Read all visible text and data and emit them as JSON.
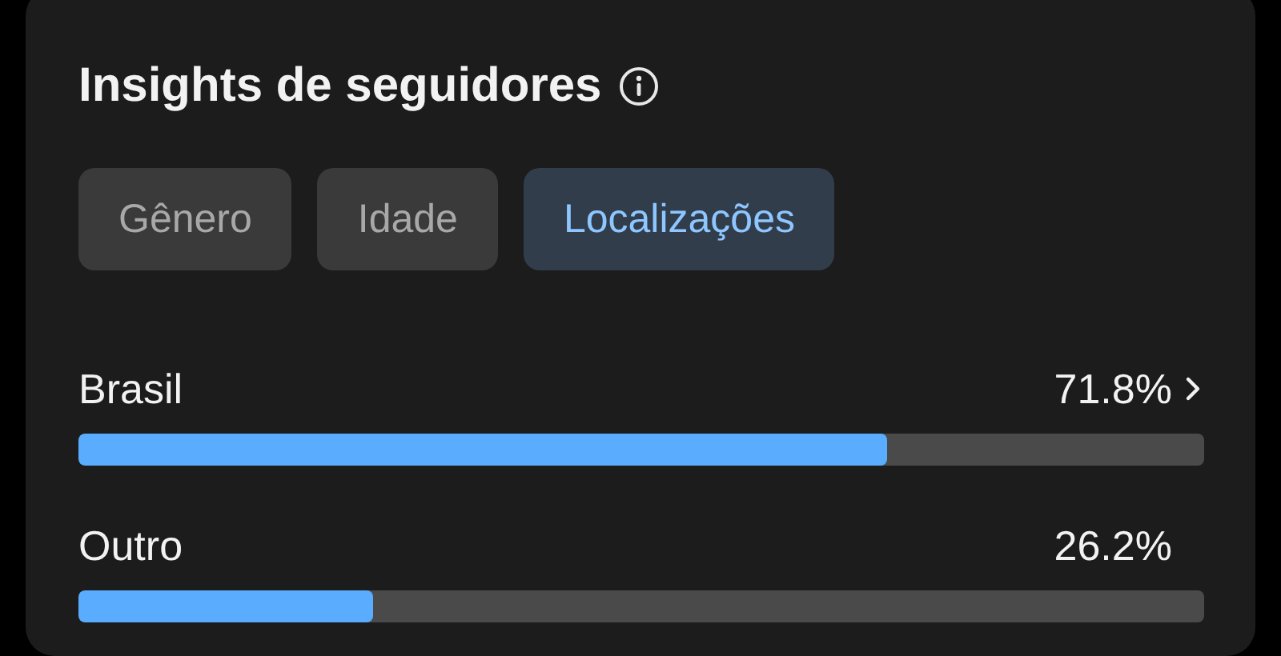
{
  "title": "Insights de seguidores",
  "tabs": [
    {
      "label": "Gênero",
      "selected": false
    },
    {
      "label": "Idade",
      "selected": false
    },
    {
      "label": "Localizações",
      "selected": true
    }
  ],
  "locations": [
    {
      "name": "Brasil",
      "reading": "71.8%",
      "level": 0.718,
      "chevron": true
    },
    {
      "name": "Outro",
      "reading": "26.2%",
      "level": 0.262,
      "chevron": false
    }
  ]
}
